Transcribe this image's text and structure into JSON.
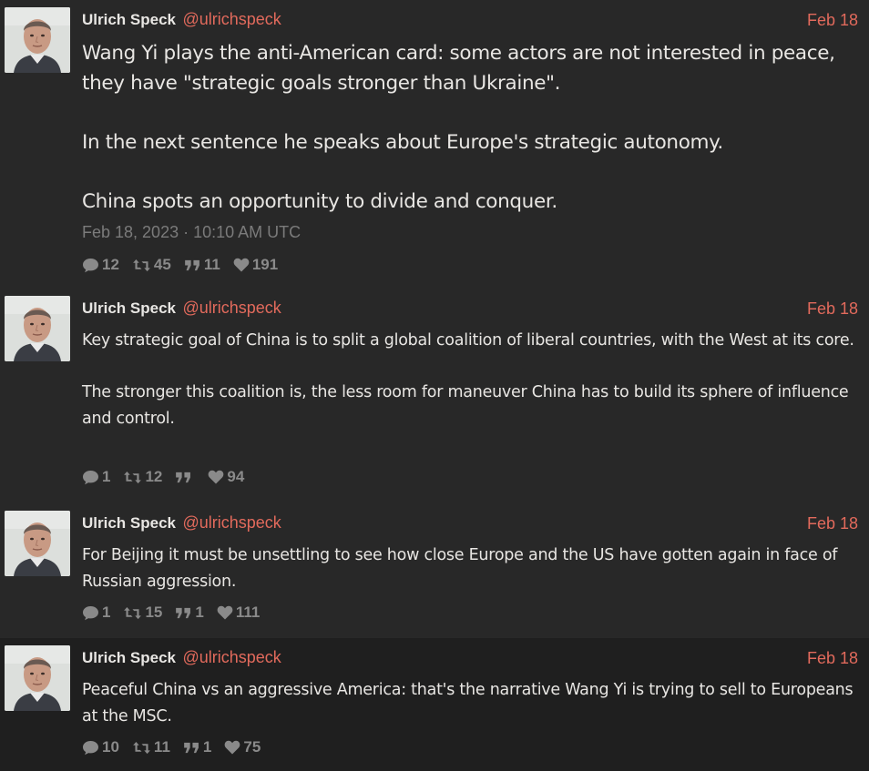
{
  "colors": {
    "background": "#282828",
    "last_tweet_background": "#1f1f1f",
    "accent": "#e26a5c",
    "muted": "#8a8a8a",
    "thread_line": "#7a3a3a"
  },
  "tweets": [
    {
      "fullname": "Ulrich Speck",
      "username": "@ulrichspeck",
      "date": "Feb 18",
      "content": "Wang Yi plays the anti-American card: some actors are not interested in peace, they have \"strategic goals stronger than Ukraine\".\n\nIn the next sentence he speaks about Europe's strategic autonomy.\n\nChina spots an opportunity to divide and conquer.",
      "published": "Feb 18, 2023 · 10:10 AM UTC",
      "stats": {
        "comments": "12",
        "retweets": "45",
        "quotes": "11",
        "likes": "191"
      }
    },
    {
      "fullname": "Ulrich Speck",
      "username": "@ulrichspeck",
      "date": "Feb 18",
      "content": "Key strategic goal of China is to split a global coalition of liberal countries, with the West at its core.\n\nThe stronger this coalition is, the less room for maneuver China has to build its sphere of influence and control.",
      "stats": {
        "comments": "1",
        "retweets": "12",
        "quotes": "",
        "likes": "94"
      }
    },
    {
      "fullname": "Ulrich Speck",
      "username": "@ulrichspeck",
      "date": "Feb 18",
      "content": "For Beijing it must be unsettling to see how close Europe and the US have gotten again in face of Russian aggression.",
      "stats": {
        "comments": "1",
        "retweets": "15",
        "quotes": "1",
        "likes": "111"
      }
    },
    {
      "fullname": "Ulrich Speck",
      "username": "@ulrichspeck",
      "date": "Feb 18",
      "content": "Peaceful China vs an aggressive America: that's the narrative Wang Yi is trying to sell to Europeans at the MSC.",
      "stats": {
        "comments": "10",
        "retweets": "11",
        "quotes": "1",
        "likes": "75"
      }
    }
  ]
}
